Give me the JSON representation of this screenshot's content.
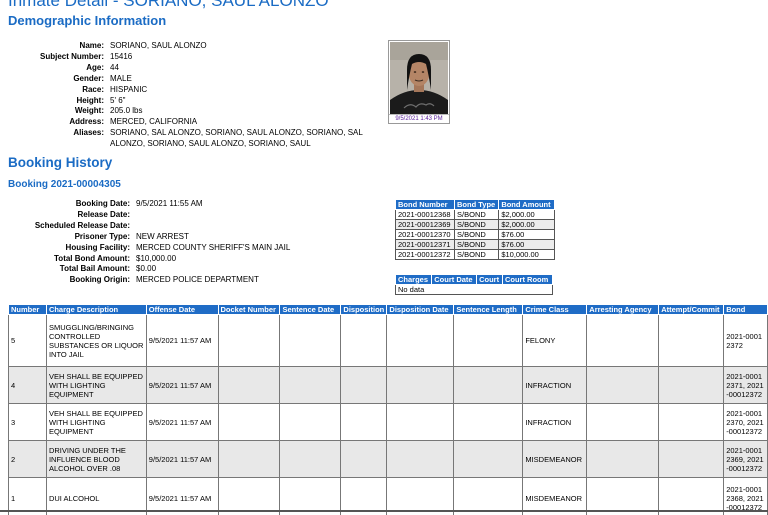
{
  "page": {
    "title": "Inmate Detail - SORIANO, SAUL ALONZO"
  },
  "demographics": {
    "heading": "Demographic Information",
    "fields": [
      {
        "label": "Name:",
        "value": "SORIANO, SAUL ALONZO"
      },
      {
        "label": "Subject Number:",
        "value": "15416"
      },
      {
        "label": "Age:",
        "value": "44"
      },
      {
        "label": "Gender:",
        "value": "MALE"
      },
      {
        "label": "Race:",
        "value": "HISPANIC"
      },
      {
        "label": "Height:",
        "value": "5' 6\""
      },
      {
        "label": "Weight:",
        "value": "205.0 lbs"
      },
      {
        "label": "Address:",
        "value": "MERCED, CALIFORNIA"
      },
      {
        "label": "Aliases:",
        "value": "SORIANO, SAL ALONZO, SORIANO, SAUL ALONZO, SORIANO, SAL"
      },
      {
        "label": "",
        "value": "ALONZO, SORIANO, SAUL ALONZO, SORIANO, SAUL"
      }
    ],
    "photo_caption": "9/5/2021 1:43 PM"
  },
  "booking_history": {
    "heading": "Booking History",
    "booking_title": "Booking 2021-00004305",
    "fields": [
      {
        "label": "Booking Date:",
        "value": "9/5/2021 11:55 AM"
      },
      {
        "label": "Release Date:",
        "value": ""
      },
      {
        "label": "Scheduled Release Date:",
        "value": ""
      },
      {
        "label": "Prisoner Type:",
        "value": "NEW ARREST"
      },
      {
        "label": "Housing Facility:",
        "value": "MERCED COUNTY SHERIFF'S MAIN JAIL"
      },
      {
        "label": "Total Bond Amount:",
        "value": "$10,000.00"
      },
      {
        "label": "Total Bail Amount:",
        "value": "$0.00"
      },
      {
        "label": "Booking Origin:",
        "value": "MERCED POLICE DEPARTMENT"
      }
    ],
    "bonds": {
      "headers": [
        "Bond Number",
        "Bond Type",
        "Bond Amount"
      ],
      "rows": [
        [
          "2021-00012368",
          "S/BOND",
          "$2,000.00"
        ],
        [
          "2021-00012369",
          "S/BOND",
          "$2,000.00"
        ],
        [
          "2021-00012370",
          "S/BOND",
          "$76.00"
        ],
        [
          "2021-00012371",
          "S/BOND",
          "$76.00"
        ],
        [
          "2021-00012372",
          "S/BOND",
          "$10,000.00"
        ]
      ]
    },
    "court": {
      "headers": [
        "Charges",
        "Court Date",
        "Court",
        "Court Room"
      ],
      "no_data": "No data"
    }
  },
  "charges": {
    "headers": [
      "Number",
      "Charge Description",
      "Offense Date",
      "Docket Number",
      "Sentence Date",
      "Disposition",
      "Disposition Date",
      "Sentence Length",
      "Crime Class",
      "Arresting Agency",
      "Attempt/Commit",
      "Bond"
    ],
    "rows": [
      {
        "number": "5",
        "description": "SMUGGLING/BRINGING CONTROLLED SUBSTANCES OR LIQUOR INTO JAIL",
        "offense_date": "9/5/2021 11:57 AM",
        "crime_class": "FELONY",
        "bond": "2021-00012372"
      },
      {
        "number": "4",
        "description": "VEH SHALL BE EQUIPPED WITH LIGHTING EQUIPMENT",
        "offense_date": "9/5/2021 11:57 AM",
        "crime_class": "INFRACTION",
        "bond": "2021-00012371, 2021-00012372"
      },
      {
        "number": "3",
        "description": "VEH SHALL BE EQUIPPED WITH LIGHTING EQUIPMENT",
        "offense_date": "9/5/2021 11:57 AM",
        "crime_class": "INFRACTION",
        "bond": "2021-00012370, 2021-00012372"
      },
      {
        "number": "2",
        "description": "DRIVING UNDER THE INFLUENCE BLOOD ALCOHOL OVER .08",
        "offense_date": "9/5/2021 11:57 AM",
        "crime_class": "MISDEMEANOR",
        "bond": "2021-00012369, 2021-00012372"
      },
      {
        "number": "1",
        "description": "DUI ALCOHOL",
        "offense_date": "9/5/2021 11:57 AM",
        "crime_class": "MISDEMEANOR",
        "bond": "2021-00012368, 2021-00012372"
      }
    ]
  }
}
